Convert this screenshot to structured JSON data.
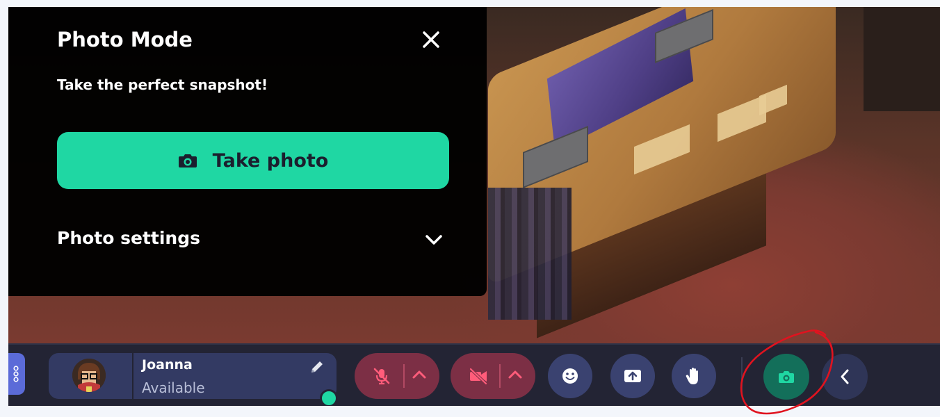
{
  "photo_panel": {
    "title": "Photo Mode",
    "subtitle": "Take the perfect snapshot!",
    "take_photo_label": "Take photo",
    "settings_label": "Photo settings"
  },
  "toolbar": {
    "user_name": "Joanna",
    "user_status": "Available"
  },
  "colors": {
    "accent": "#1fd7a3",
    "panel_bg": "#000000",
    "toolbar_bg": "#232434",
    "mic_off_bg": "#7c2f45",
    "annotation": "#e0131f"
  },
  "icons": {
    "close": "close-icon",
    "camera": "camera-icon",
    "chevron": "chevron-down-icon",
    "mic_off": "mic-off-icon",
    "video_off": "video-off-icon",
    "emoji": "emoji-icon",
    "share": "share-screen-icon",
    "hand": "raise-hand-icon",
    "edit": "pencil-icon",
    "apps": "apps-icon",
    "collapse": "chevron-left-icon"
  }
}
